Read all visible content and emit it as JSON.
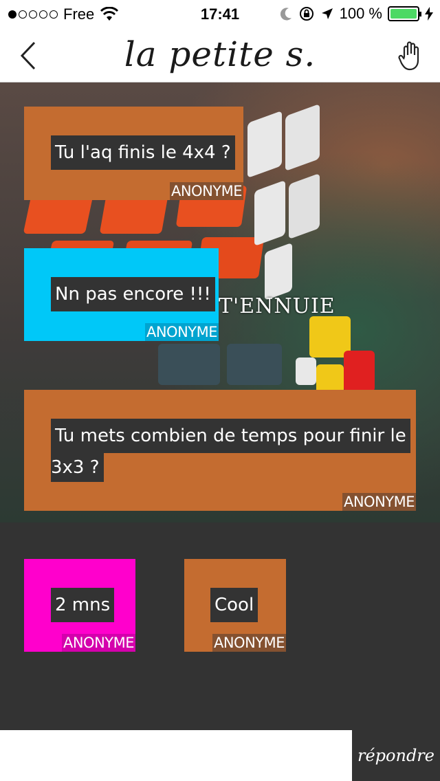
{
  "status_bar": {
    "carrier": "Free",
    "time": "17:41",
    "battery": "100 %"
  },
  "nav": {
    "logo": "la petite s."
  },
  "photo": {
    "overlay_text": "T'ENNUIE"
  },
  "messages": [
    {
      "text": "Tu l'aq finis le 4x4 ?",
      "author": "ANONYME",
      "color": "#c46c30"
    },
    {
      "text": "Nn pas encore !!!",
      "author": "ANONYME",
      "color": "#00c8f8"
    },
    {
      "text": "Tu mets combien de temps pour finir le",
      "text2": "3x3 ?",
      "author": "ANONYME",
      "color": "#c46c30"
    },
    {
      "text": "2 mns",
      "author": "ANONYME",
      "color": "#ff00cc"
    },
    {
      "text": "Cool",
      "author": "ANONYME",
      "color": "#c46c30"
    }
  ],
  "bottom": {
    "reply_label": "répondre",
    "reply_placeholder": ""
  }
}
